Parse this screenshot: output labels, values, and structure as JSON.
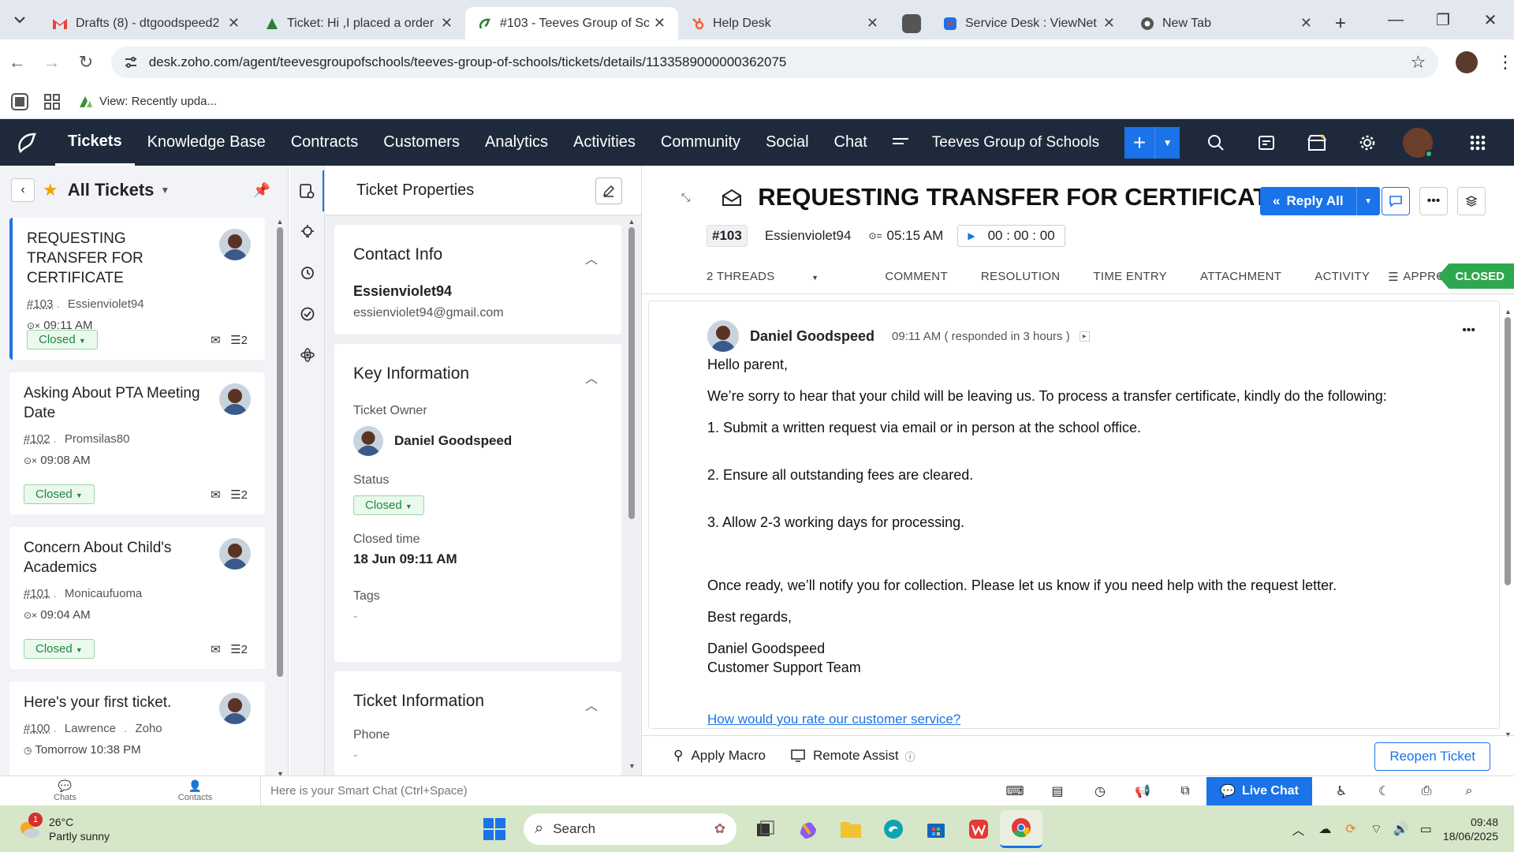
{
  "browser": {
    "tabs": [
      {
        "title": "Drafts (8) - dtgoodspeed2",
        "icon": "gmail-icon"
      },
      {
        "title": "Ticket: Hi ,I placed a order",
        "icon": "zoho-icon"
      },
      {
        "title": "#103 - Teeves Group of Sc",
        "icon": "zoho-desk-icon",
        "active": true
      },
      {
        "title": "Help Desk",
        "icon": "hubspot-icon"
      },
      {
        "title": "Service Desk : ViewNet Co",
        "icon": "viewnet-icon"
      },
      {
        "title": "New Tab",
        "icon": "chrome-icon"
      }
    ],
    "url": "desk.zoho.com/agent/teevesgroupofschools/teeves-group-of-schools/tickets/details/1133589000000362075",
    "bookmark": "View: Recently upda..."
  },
  "nav": {
    "items": [
      "Tickets",
      "Knowledge Base",
      "Contracts",
      "Customers",
      "Analytics",
      "Activities",
      "Community",
      "Social",
      "Chat"
    ],
    "org": "Teeves Group of Schools"
  },
  "list": {
    "title": "All Tickets",
    "tickets": [
      {
        "subject": "REQUESTING TRANSFER FOR CERTIFICATE",
        "id": "#103",
        "contact": "Essienviolet94",
        "time": "09:11 AM",
        "status": "Closed",
        "threads": "2"
      },
      {
        "subject": "Asking About PTA Meeting Date",
        "id": "#102",
        "contact": "Promsilas80",
        "time": "09:08 AM",
        "status": "Closed",
        "threads": "2"
      },
      {
        "subject": "Concern About Child's Academics",
        "id": "#101",
        "contact": "Monicaufuoma",
        "time": "09:04 AM",
        "status": "Closed",
        "threads": "2"
      },
      {
        "subject": "Here's your first ticket.",
        "id": "#100",
        "contact": "Lawrence",
        "contact2": "Zoho",
        "time": "Tomorrow 10:38 PM"
      }
    ]
  },
  "props": {
    "header": "Ticket Properties",
    "contact": {
      "title": "Contact Info",
      "name": "Essienviolet94",
      "email": "essienviolet94@gmail.com"
    },
    "key": {
      "title": "Key Information",
      "owner_label": "Ticket Owner",
      "owner": "Daniel Goodspeed",
      "status_label": "Status",
      "status": "Closed",
      "closed_label": "Closed time",
      "closed": "18 Jun 09:11 AM",
      "tags_label": "Tags",
      "tags": "-"
    },
    "info": {
      "title": "Ticket Information",
      "phone_label": "Phone",
      "phone": "-"
    }
  },
  "ticket": {
    "title": "REQUESTING TRANSFER FOR CERTIFICATE",
    "reply_label": "Reply All",
    "id": "#103",
    "contact": "Essienviolet94",
    "time": "05:15 AM",
    "timer": "00 : 00 : 00",
    "tabs": [
      "2 THREADS",
      "COMMENT",
      "RESOLUTION",
      "TIME ENTRY",
      "ATTACHMENT",
      "ACTIVITY",
      "APPROVAL"
    ],
    "status_tag": "CLOSED",
    "thread": {
      "author": "Daniel Goodspeed",
      "time": "09:11 AM ( responded in 3 hours )",
      "greeting": "Hello parent,",
      "l1": "We’re sorry to hear that your child will be leaving us. To process a transfer certificate, kindly do the following:",
      "s1": "1. Submit a written request via email or in person at the school office.",
      "s2": "2. Ensure all outstanding fees are cleared.",
      "s3": "3. Allow 2-3 working days for processing.",
      "l2": "Once ready, we’ll notify you for collection. Please let us know if you need help with the request letter.",
      "regards": "Best regards,",
      "sig1": "Daniel Goodspeed",
      "sig2": "Customer Support Team",
      "rate": "How would you rate our customer service?"
    },
    "footer": {
      "macro": "Apply Macro",
      "remote": "Remote Assist",
      "reopen": "Reopen Ticket"
    }
  },
  "statusbar": {
    "chats": "Chats",
    "contacts": "Contacts",
    "smartchat": "Here is your Smart Chat (Ctrl+Space)",
    "livechat": "Live Chat"
  },
  "taskbar": {
    "temp": "26°C",
    "weather": "Partly sunny",
    "badge": "1",
    "search": "Search",
    "time": "09:48",
    "date": "18/06/2025"
  },
  "colors": {
    "accent": "#1a73e8",
    "nav_bg": "#1e2a3b",
    "closed_green": "#2ea84f"
  }
}
